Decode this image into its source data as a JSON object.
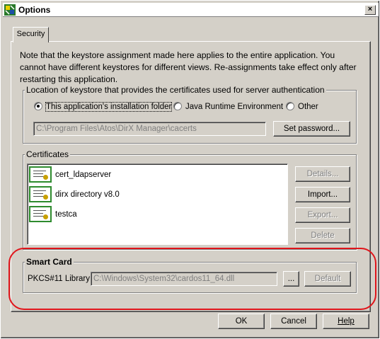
{
  "window": {
    "title": "Options",
    "close_label": "×"
  },
  "tabs": [
    {
      "label": "Security"
    }
  ],
  "note": "Note that the keystore assignment made here applies to the entire application. You cannot have different keystores for different views. Re-assignments take effect only after restarting this application.",
  "keystore": {
    "group_title": "Location of keystore that provides the certificates used for server authentication",
    "options": [
      {
        "label": "This application's installation folder",
        "selected": true
      },
      {
        "label": "Java Runtime Environment",
        "selected": false
      },
      {
        "label": "Other",
        "selected": false
      }
    ],
    "path": "C:\\Program Files\\Atos\\DirX Manager\\cacerts",
    "set_password_label": "Set password..."
  },
  "certificates": {
    "group_title": "Certificates",
    "items": [
      {
        "name": "cert_ldapserver",
        "icon": "certificate-icon"
      },
      {
        "name": "dirx directory v8.0",
        "icon": "certificate-icon"
      },
      {
        "name": "testca",
        "icon": "certificate-icon"
      }
    ],
    "buttons": {
      "details": "Details...",
      "import": "Import...",
      "export": "Export...",
      "delete": "Delete"
    }
  },
  "smart_card": {
    "group_title": "Smart Card",
    "library_label": "PKCS#11 Library:",
    "library_path": "C:\\Windows\\System32\\cardos11_64.dll",
    "browse_label": "...",
    "default_label": "Default"
  },
  "footer": {
    "ok": "OK",
    "cancel": "Cancel",
    "help": "Help"
  },
  "colors": {
    "highlight": "#e0151b",
    "certificate_border": "#2e8b2e"
  }
}
